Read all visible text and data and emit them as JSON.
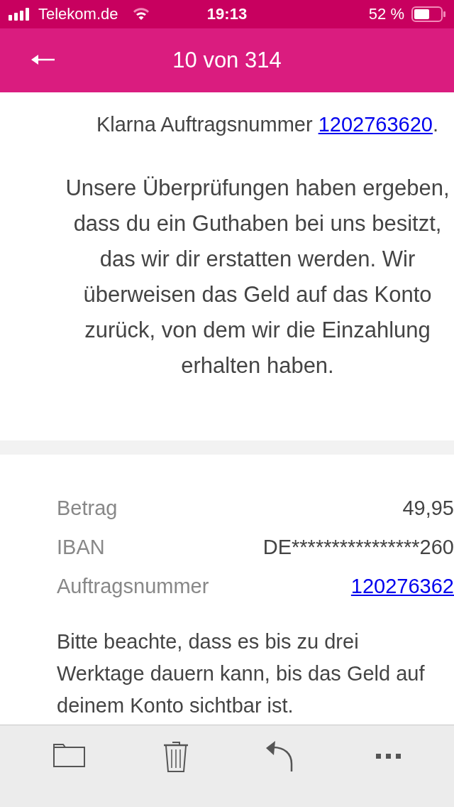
{
  "status_bar": {
    "carrier": "Telekom.de",
    "time": "19:13",
    "battery": "52 %"
  },
  "header": {
    "title": "10 von 314"
  },
  "message": {
    "intro": {
      "text": "Klarna Auftragsnummer ",
      "link": "1202763620",
      "after": "."
    },
    "paragraph": "Unsere Überprüfungen haben ergeben, dass du ein Guthaben bei uns besitzt, das wir dir erstatten werden. Wir überweisen das Geld auf das Konto zurück, von dem wir die Einzahlung erhalten haben.",
    "details": [
      {
        "label": "Betrag",
        "value": "49,95",
        "kind": "text"
      },
      {
        "label": "IBAN",
        "value": "DE****************260",
        "kind": "text"
      },
      {
        "label": "Auftragsnummer",
        "value": "120276362",
        "kind": "link"
      }
    ],
    "note": "Bitte beachte, dass es bis zu drei Werktage dauern kann, bis das Geld auf deinem Konto sichtbar ist."
  },
  "toolbar": [
    {
      "kind": "folder"
    },
    {
      "kind": "trash"
    },
    {
      "kind": "reply"
    },
    {
      "kind": "more"
    }
  ]
}
